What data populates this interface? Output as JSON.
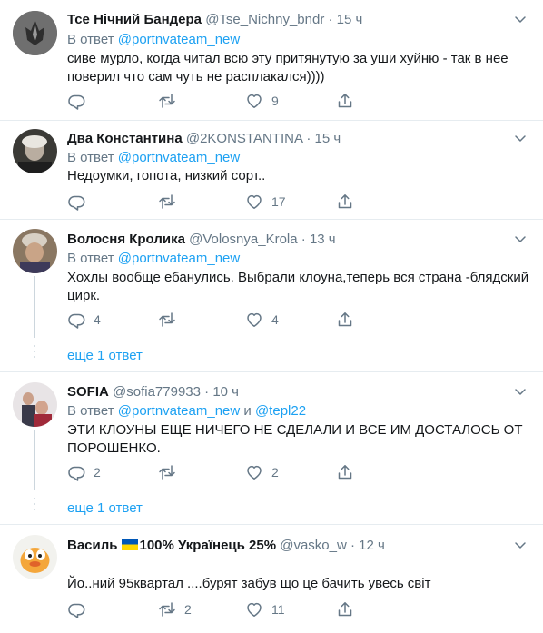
{
  "ui": {
    "reply_prefix": "В ответ",
    "and_word": "и",
    "more_replies": "еще 1 ответ",
    "dot": "·"
  },
  "tweets": [
    {
      "name": "Тсе Нічний Бандера",
      "handle": "@Tse_Nichny_bndr",
      "time": "15 ч",
      "reply_to": "@portnvateam_new",
      "text": "сиве мурло, когда читал всю эту притянутую за уши хуйню - так в нее поверил что сам чуть не расплакался))))",
      "replies": "",
      "retweets": "",
      "likes": "9"
    },
    {
      "name": "Два Константина",
      "handle": "@2KONSTANTINA",
      "time": "15 ч",
      "reply_to": "@portnvateam_new",
      "text": "Недоумки, гопота, низкий сорт..",
      "replies": "",
      "retweets": "",
      "likes": "17"
    },
    {
      "name": "Волосня Кролика",
      "handle": "@Volosnya_Krola",
      "time": "13 ч",
      "reply_to": "@portnvateam_new",
      "text": "Хохлы вообще ебанулись. Выбрали клоуна,теперь вся страна -блядский цирк.",
      "replies": "4",
      "retweets": "",
      "likes": "4"
    },
    {
      "name": "SOFIA",
      "handle": "@sofia779933",
      "time": "10 ч",
      "reply_to": "@portnvateam_new",
      "reply_to_2": "@tepl22",
      "text": "ЭТИ КЛОУНЫ ЕЩЕ НИЧЕГО НЕ СДЕЛАЛИ И ВСЕ ИМ ДОСТАЛОСЬ ОТ ПОРОШЕНКО.",
      "replies": "2",
      "retweets": "",
      "likes": "2"
    },
    {
      "name_pre": "Василь",
      "name_post": "100% Українець 25%",
      "handle": "@vasko_w",
      "time": "12 ч",
      "text": "Йо..ний 95квартал ....бурят забув що це бачить увесь світ",
      "replies": "",
      "retweets": "2",
      "likes": "11"
    }
  ],
  "colors": {
    "accent": "#1da1f2",
    "muted": "#657786",
    "text": "#14171a",
    "separator": "#e6ecf0",
    "thread_line": "#ccd6dd",
    "flag_blue": "#0057b7",
    "flag_yellow": "#ffd700"
  }
}
